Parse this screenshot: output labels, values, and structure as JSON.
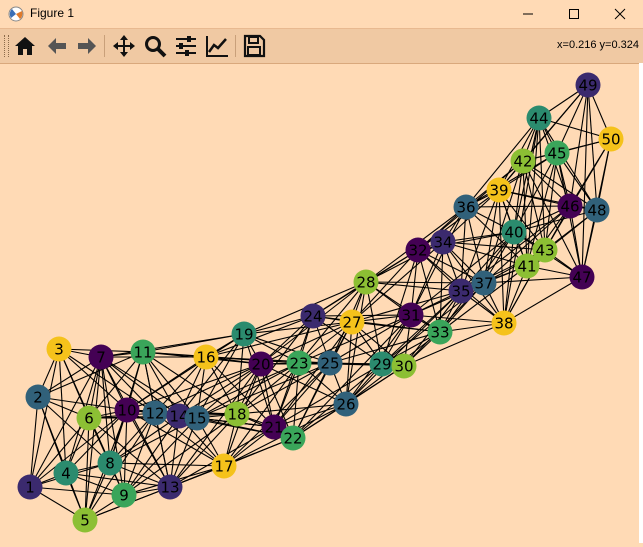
{
  "window": {
    "title": "Figure 1",
    "app_icon": "matplotlib-icon",
    "controls": [
      "minimize-icon",
      "maximize-icon",
      "close-icon"
    ]
  },
  "toolbar": {
    "buttons": [
      {
        "name": "home-button",
        "icon": "home-icon"
      },
      {
        "name": "back-button",
        "icon": "arrow-left-icon"
      },
      {
        "name": "forward-button",
        "icon": "arrow-right-icon"
      },
      {
        "name": "pan-button",
        "icon": "move-icon"
      },
      {
        "name": "zoom-button",
        "icon": "magnifier-icon"
      },
      {
        "name": "configure-subplots-button",
        "icon": "sliders-icon"
      },
      {
        "name": "edit-axis-button",
        "icon": "line-chart-icon"
      },
      {
        "name": "save-button",
        "icon": "floppy-disk-icon"
      }
    ],
    "coords": "x=0.216 y=0.324"
  },
  "graph": {
    "background": "#ffdab5",
    "edge_color": "#000000",
    "palette": {
      "purple": "#440154",
      "indigo": "#3b2a6e",
      "slate": "#31617a",
      "teal": "#2b8b6e",
      "green": "#3aa55a",
      "lime": "#8cbf34",
      "yellow": "#f5c21b"
    },
    "nodes": [
      {
        "label": "1",
        "color": "indigo"
      },
      {
        "label": "2",
        "color": "slate"
      },
      {
        "label": "3",
        "color": "yellow"
      },
      {
        "label": "4",
        "color": "teal"
      },
      {
        "label": "5",
        "color": "lime"
      },
      {
        "label": "6",
        "color": "lime"
      },
      {
        "label": "7",
        "color": "purple"
      },
      {
        "label": "8",
        "color": "teal"
      },
      {
        "label": "9",
        "color": "green"
      },
      {
        "label": "10",
        "color": "purple"
      },
      {
        "label": "11",
        "color": "green"
      },
      {
        "label": "12",
        "color": "slate"
      },
      {
        "label": "13",
        "color": "indigo"
      },
      {
        "label": "14",
        "color": "indigo"
      },
      {
        "label": "15",
        "color": "slate"
      },
      {
        "label": "16",
        "color": "yellow"
      },
      {
        "label": "17",
        "color": "yellow"
      },
      {
        "label": "18",
        "color": "lime"
      },
      {
        "label": "19",
        "color": "teal"
      },
      {
        "label": "20",
        "color": "purple"
      },
      {
        "label": "21",
        "color": "purple"
      },
      {
        "label": "22",
        "color": "green"
      },
      {
        "label": "23",
        "color": "green"
      },
      {
        "label": "24",
        "color": "indigo"
      },
      {
        "label": "25",
        "color": "slate"
      },
      {
        "label": "26",
        "color": "slate"
      },
      {
        "label": "27",
        "color": "yellow"
      },
      {
        "label": "28",
        "color": "lime"
      },
      {
        "label": "29",
        "color": "teal"
      },
      {
        "label": "30",
        "color": "lime"
      },
      {
        "label": "31",
        "color": "purple"
      },
      {
        "label": "32",
        "color": "purple"
      },
      {
        "label": "33",
        "color": "green"
      },
      {
        "label": "34",
        "color": "indigo"
      },
      {
        "label": "35",
        "color": "indigo"
      },
      {
        "label": "36",
        "color": "slate"
      },
      {
        "label": "37",
        "color": "slate"
      },
      {
        "label": "38",
        "color": "yellow"
      },
      {
        "label": "39",
        "color": "yellow"
      },
      {
        "label": "40",
        "color": "teal"
      },
      {
        "label": "41",
        "color": "lime"
      },
      {
        "label": "42",
        "color": "lime"
      },
      {
        "label": "43",
        "color": "lime"
      },
      {
        "label": "44",
        "color": "teal"
      },
      {
        "label": "45",
        "color": "green"
      },
      {
        "label": "46",
        "color": "purple"
      },
      {
        "label": "47",
        "color": "purple"
      },
      {
        "label": "48",
        "color": "slate"
      },
      {
        "label": "49",
        "color": "indigo"
      },
      {
        "label": "50",
        "color": "yellow"
      }
    ]
  }
}
